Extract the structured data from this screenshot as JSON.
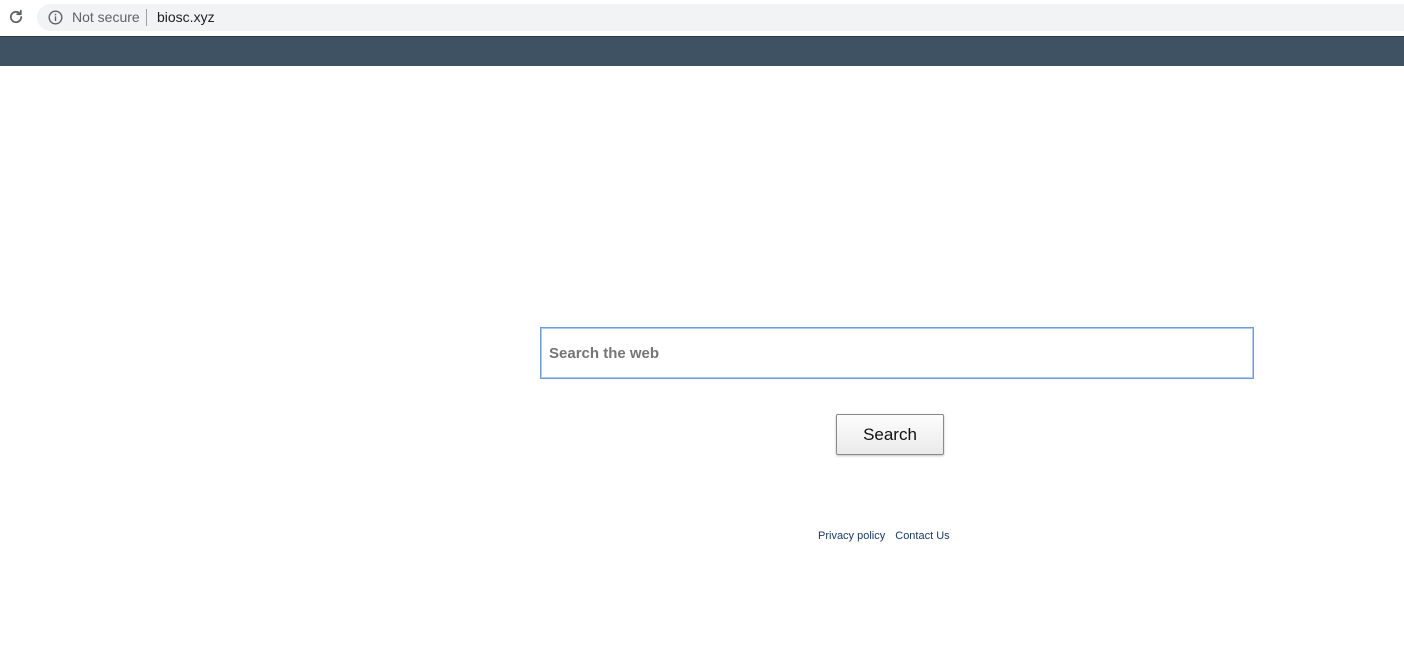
{
  "browser": {
    "security_label": "Not secure",
    "url": "biosc.xyz",
    "icons": {
      "reload": "reload-icon",
      "info": "info-icon"
    }
  },
  "header": {
    "background_color": "#3e5263"
  },
  "search": {
    "placeholder": "Search the web",
    "value": "",
    "button_label": "Search"
  },
  "footer": {
    "links": [
      {
        "label": "Privacy policy"
      },
      {
        "label": "Contact Us"
      }
    ]
  }
}
